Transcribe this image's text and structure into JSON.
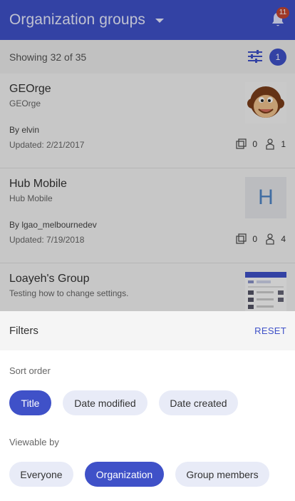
{
  "header": {
    "title": "Organization groups",
    "notification_count": "11"
  },
  "list": {
    "showing_text": "Showing 32 of 35",
    "active_filters_count": "1",
    "groups": [
      {
        "title": "GEOrge",
        "subtitle": "GEOrge",
        "by": "By elvin",
        "updated": "Updated: 2/21/2017",
        "items": "0",
        "members": "1",
        "thumbnail": "curious-george-monkey"
      },
      {
        "title": "Hub Mobile",
        "subtitle": "Hub Mobile",
        "by": "By lgao_melbournedev",
        "updated": "Updated: 7/19/2018",
        "items": "0",
        "members": "4",
        "thumbnail_letter": "H"
      },
      {
        "title": "Loayeh's Group",
        "subtitle": "Testing how to change settings.",
        "thumbnail": "screenshot-thumbnail"
      }
    ]
  },
  "filters": {
    "title": "Filters",
    "reset_label": "RESET",
    "sort_order": {
      "label": "Sort order",
      "options": [
        "Title",
        "Date modified",
        "Date created"
      ],
      "selected": "Title"
    },
    "viewable_by": {
      "label": "Viewable by",
      "options": [
        "Everyone",
        "Organization",
        "Group members"
      ],
      "selected": "Organization"
    }
  },
  "colors": {
    "primary": "#3f51c8",
    "badge": "#c24530",
    "chip_off": "#e8ebf7"
  }
}
